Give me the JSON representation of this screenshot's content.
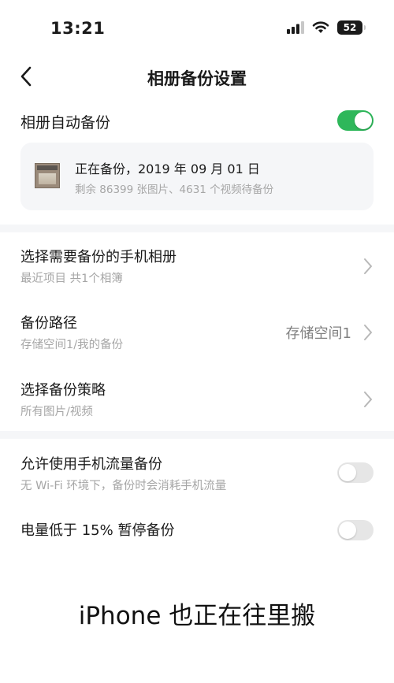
{
  "status_bar": {
    "time": "13:21",
    "battery": "52",
    "icons": [
      "signal-icon",
      "wifi-icon",
      "battery-icon"
    ]
  },
  "nav": {
    "title": "相册备份设置",
    "back_icon": "chevron-left-icon"
  },
  "auto_backup": {
    "label": "相册自动备份",
    "enabled": true
  },
  "progress_card": {
    "title": "正在备份，2019 年 09 月 01 日",
    "subtitle": "剩余 86399 张图片、4631 个视频待备份"
  },
  "settings": [
    {
      "title": "选择需要备份的手机相册",
      "subtitle": "最近项目 共1个相簿",
      "value": ""
    },
    {
      "title": "备份路径",
      "subtitle": "存储空间1/我的备份",
      "value": "存储空间1"
    },
    {
      "title": "选择备份策略",
      "subtitle": "所有图片/视频",
      "value": ""
    }
  ],
  "toggles": [
    {
      "title": "允许使用手机流量备份",
      "subtitle": "无 Wi-Fi 环境下，备份时会消耗手机流量",
      "enabled": false
    },
    {
      "title": "电量低于 15% 暂停备份",
      "subtitle": "",
      "enabled": false
    }
  ],
  "caption": "iPhone 也正在往里搬",
  "colors": {
    "toggle_on": "#2eb75a",
    "toggle_off": "#e6e6e6",
    "card_bg": "#f5f6f8",
    "secondary_text": "#a6a6a6"
  }
}
